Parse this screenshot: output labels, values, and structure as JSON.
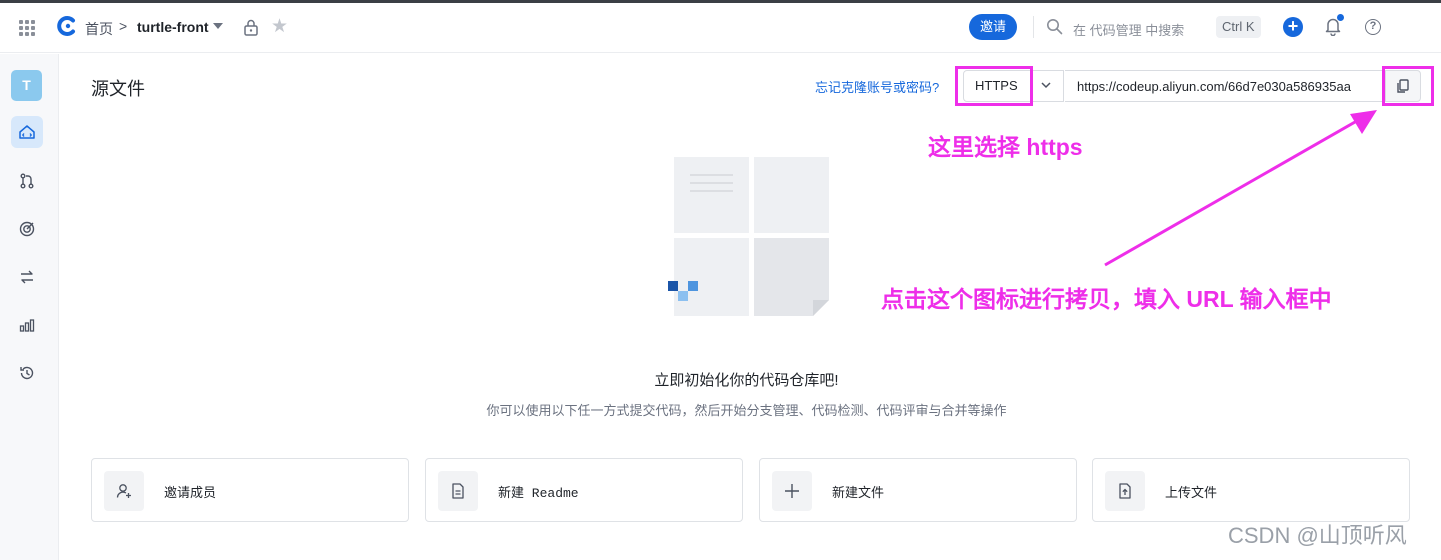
{
  "header": {
    "breadcrumb_home": "首页",
    "breadcrumb_sep": ">",
    "repo_name": "turtle-front",
    "invite_label": "邀请",
    "search_placeholder": "在 代码管理 中搜索",
    "search_shortcut": "Ctrl K",
    "help_label": "?"
  },
  "sidebar": {
    "avatar_letter": "T",
    "items": [
      {
        "icon": "code-files-icon",
        "active": true
      },
      {
        "icon": "merge-request-icon",
        "active": false
      },
      {
        "icon": "target-icon",
        "active": false
      },
      {
        "icon": "sync-arrows-icon",
        "active": false
      },
      {
        "icon": "bar-chart-icon",
        "active": false
      },
      {
        "icon": "history-icon",
        "active": false
      }
    ]
  },
  "main": {
    "title": "源文件",
    "forgot_link": "忘记克隆账号或密码?",
    "protocol_value": "HTTPS",
    "clone_url": "https://codeup.aliyun.com/66d7e030a586935aa",
    "empty_title": "立即初始化你的代码仓库吧!",
    "empty_subtitle": "你可以使用以下任一方式提交代码，然后开始分支管理、代码检测、代码评审与合并等操作",
    "cards": [
      {
        "label": "邀请成员",
        "icon": "add-user-icon"
      },
      {
        "label": "新建 Readme",
        "icon": "document-icon"
      },
      {
        "label": "新建文件",
        "icon": "plus-icon"
      },
      {
        "label": "上传文件",
        "icon": "upload-file-icon"
      }
    ]
  },
  "annotations": {
    "note_https": "这里选择 https",
    "note_copy": "点击这个图标进行拷贝，填入 URL 输入框中",
    "highlight_color": "#ee2ee9"
  },
  "watermark": "CSDN @山顶听风",
  "colors": {
    "brand": "#1668dc",
    "active_nav_bg": "#d7e8fb",
    "avatar_bg": "#8bc9ee"
  }
}
